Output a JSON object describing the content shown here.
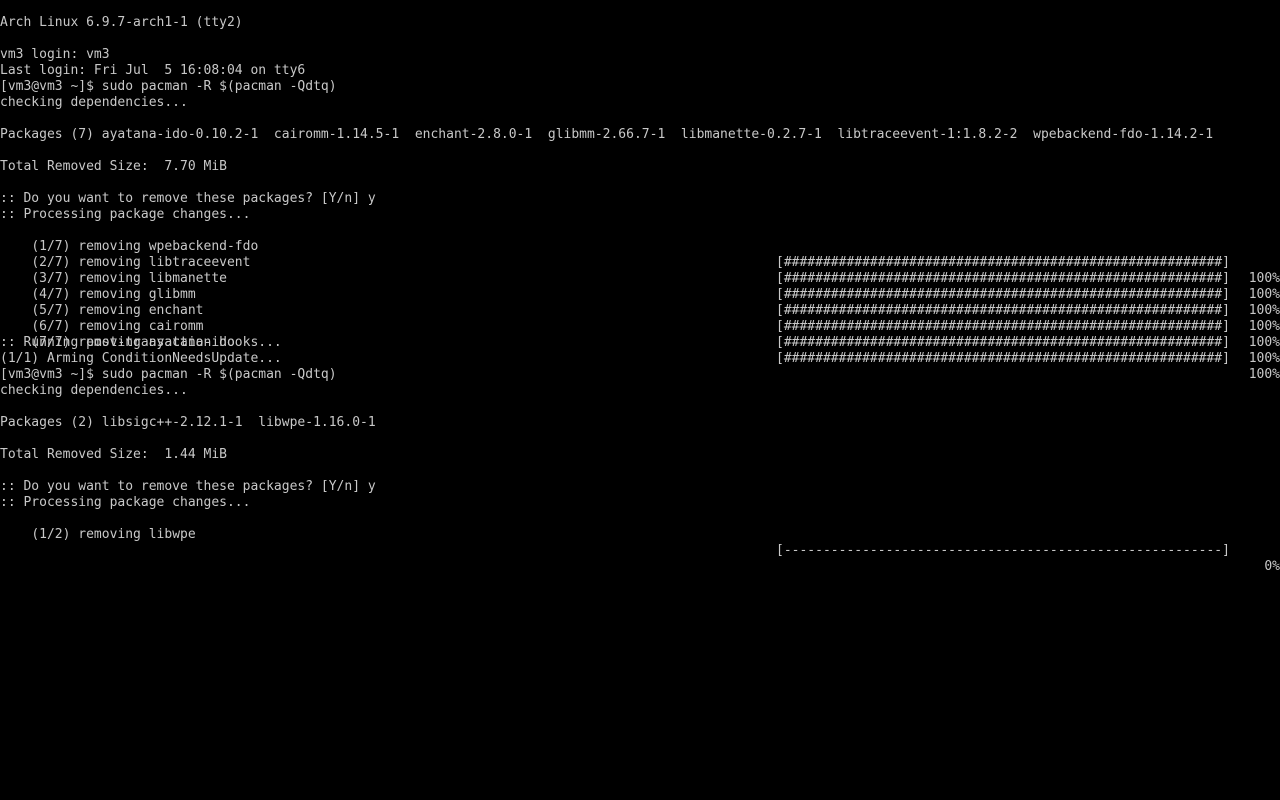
{
  "terminal": {
    "line0": "Arch Linux 6.9.7-arch1-1 (tty2)",
    "line2": "vm3 login: vm3",
    "line3": "Last login: Fri Jul  5 16:08:04 on tty6",
    "line4": "[vm3@vm3 ~]$ sudo pacman -R $(pacman -Qdtq)",
    "line5": "checking dependencies...",
    "line7": "Packages (7) ayatana-ido-0.10.2-1  cairomm-1.14.5-1  enchant-2.8.0-1  glibmm-2.66.7-1  libmanette-0.2.7-1  libtraceevent-1:1.8.2-2  wpebackend-fdo-1.14.2-1",
    "line9": "Total Removed Size:  7.70 MiB",
    "line11": ":: Do you want to remove these packages? [Y/n] y",
    "line12": ":: Processing package changes...",
    "line13": "(1/7) removing wpebackend-fdo",
    "line13_bar": "[########################################################]",
    "line13_pct": "100%",
    "line14": "(2/7) removing libtraceevent",
    "line14_bar": "[########################################################]",
    "line14_pct": "100%",
    "line15": "(3/7) removing libmanette",
    "line15_bar": "[########################################################]",
    "line15_pct": "100%",
    "line16": "(4/7) removing glibmm",
    "line16_bar": "[########################################################]",
    "line16_pct": "100%",
    "line17": "(5/7) removing enchant",
    "line17_bar": "[########################################################]",
    "line17_pct": "100%",
    "line18": "(6/7) removing cairomm",
    "line18_bar": "[########################################################]",
    "line18_pct": "100%",
    "line19": "(7/7) removing ayatana-ido",
    "line19_bar": "[########################################################]",
    "line19_pct": "100%",
    "line20": ":: Running post-transaction hooks...",
    "line21": "(1/1) Arming ConditionNeedsUpdate...",
    "line22": "[vm3@vm3 ~]$ sudo pacman -R $(pacman -Qdtq)",
    "line23": "checking dependencies...",
    "line25": "Packages (2) libsigc++-2.12.1-1  libwpe-1.16.0-1",
    "line27": "Total Removed Size:  1.44 MiB",
    "line29": ":: Do you want to remove these packages? [Y/n] y",
    "line30": ":: Processing package changes...",
    "line31": "(1/2) removing libwpe",
    "line31_bar": "[--------------------------------------------------------]",
    "line31_pct": "0%"
  },
  "progress_levels": {
    "wpebackend-fdo": 1.0,
    "libtraceevent": 1.0,
    "libmanette": 1.0,
    "glibmm": 1.0,
    "enchant": 1.0,
    "cairomm": 1.0,
    "ayatana-ido": 1.0,
    "libwpe": 0.0
  },
  "colors": {
    "background": "#000000",
    "foreground": "#c8c8c8"
  }
}
